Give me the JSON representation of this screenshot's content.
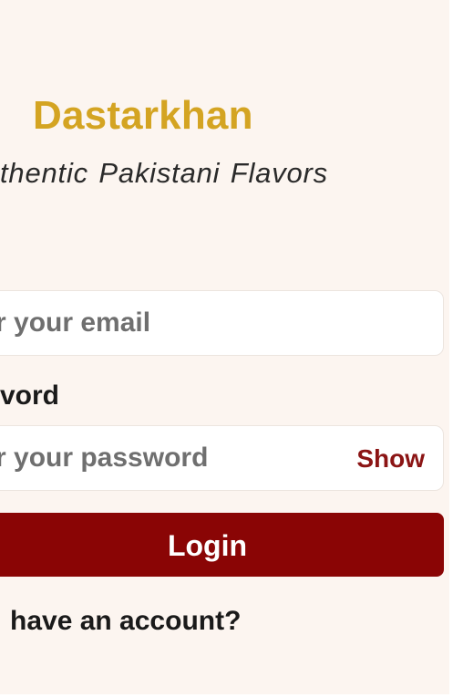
{
  "brand": {
    "name": "Dastarkhan",
    "tagline": "thentic Pakistani Flavors",
    "color": "#d4a422"
  },
  "login_form": {
    "email": {
      "value": "",
      "placeholder": "r your email"
    },
    "password": {
      "label": "vord",
      "value": "",
      "placeholder": "r your password",
      "show_label": "Show"
    },
    "submit_label": "Login",
    "signup_prompt": "have an account?"
  },
  "colors": {
    "background": "#fcf5f0",
    "primary": "#8a0505",
    "accent_text": "#8b1414"
  }
}
